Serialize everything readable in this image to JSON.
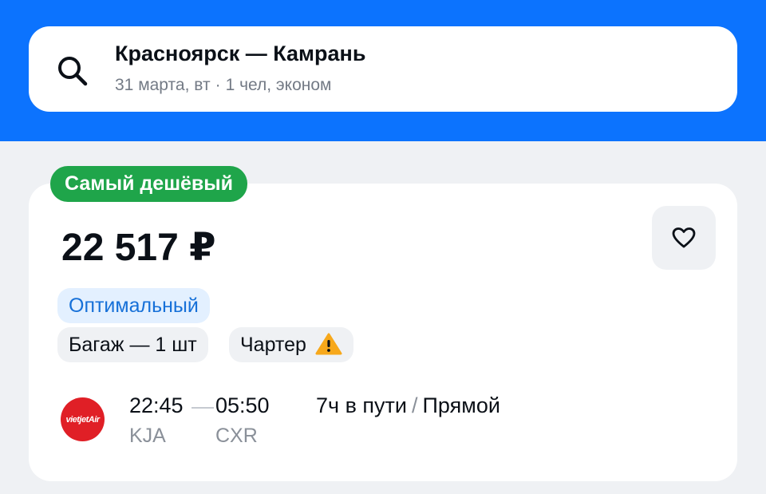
{
  "search": {
    "route": "Красноярск — Камрань",
    "date": "31 марта, вт",
    "separator": "·",
    "passengers": "1 чел, эконом"
  },
  "offer": {
    "badge": "Самый дешёвый",
    "price": "22 517 ₽",
    "tags": {
      "optimal": "Оптимальный",
      "baggage": "Багаж — 1 шт",
      "charter": "Чартер"
    }
  },
  "flight": {
    "airline_logo_text": "vietjetAir",
    "departure_time": "22:45",
    "arrival_time": "05:50",
    "departure_code": "KJA",
    "arrival_code": "CXR",
    "duration": "7ч в пути",
    "slash": "/",
    "stops": "Прямой"
  },
  "icons": {
    "search": "search-icon",
    "favorite": "heart-icon",
    "warning": "warning-icon"
  },
  "colors": {
    "header": "#0c73fe",
    "badge": "#1fa54a",
    "optimal_tag_bg": "#e3f0ff",
    "optimal_tag_text": "#1670d8",
    "warning": "#f7a81b",
    "airline": "#e01f26"
  }
}
